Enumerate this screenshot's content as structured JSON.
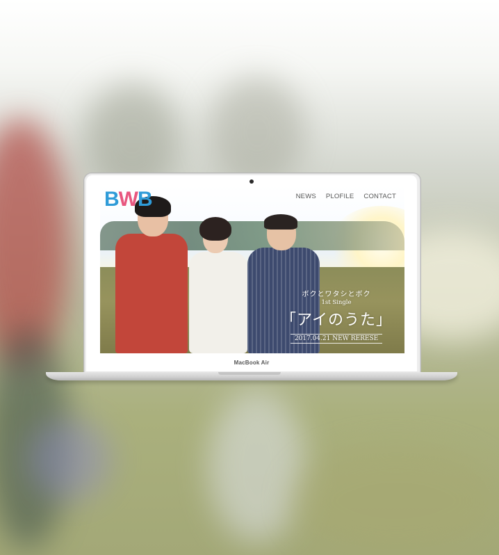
{
  "site": {
    "logo": {
      "part1": "B",
      "part2": "W",
      "part3": "B"
    },
    "nav": [
      "NEWS",
      "PLOFILE",
      "CONTACT"
    ],
    "promo": {
      "band": "ボクとワタシとボク",
      "single": "1st Single",
      "title": "「アイのうた」",
      "release": "2017.04.21 NEW RERESE"
    }
  },
  "device": {
    "model_label": "MacBook Air"
  },
  "colors": {
    "logo_blue": "#2f9bd8",
    "logo_pink": "#e8567f",
    "nav_text": "#555555"
  },
  "icons": {
    "camera": "webcam-icon"
  }
}
